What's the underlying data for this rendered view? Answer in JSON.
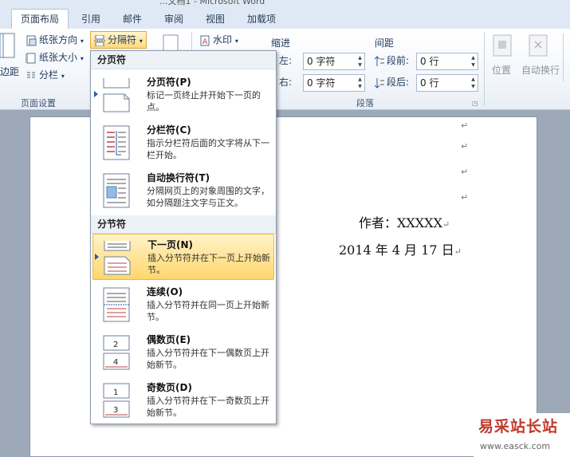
{
  "window": {
    "title_fragment": "...文档1 - Microsoft Word"
  },
  "tabs": [
    "页面布局",
    "引用",
    "邮件",
    "审阅",
    "视图",
    "加载项"
  ],
  "ribbon": {
    "margins_label": "边距",
    "orientation_label": "纸张方向",
    "size_label": "纸张大小",
    "columns_label": "分栏",
    "breaks_label": "分隔符",
    "watermark_label": "水印",
    "page_setup_group": "页面设置",
    "indent_label": "缩进",
    "indent_left_label": "左:",
    "indent_left_value": "0 字符",
    "indent_right_label": "右:",
    "indent_right_value": "0 字符",
    "spacing_label": "间距",
    "spacing_before_label": "段前:",
    "spacing_before_value": "0 行",
    "spacing_after_label": "段后:",
    "spacing_after_value": "0 行",
    "paragraph_group": "段落",
    "position_label": "位置",
    "wrap_label": "自动换行"
  },
  "menu": {
    "page_breaks_header": "分页符",
    "section_breaks_header": "分节符",
    "items": [
      {
        "title": "分页符(P)",
        "desc": "标记一页终止并开始下一页的点。"
      },
      {
        "title": "分栏符(C)",
        "desc": "指示分栏符后面的文字将从下一栏开始。"
      },
      {
        "title": "自动换行符(T)",
        "desc": "分隔网页上的对象周围的文字，如分隔题注文字与正文。"
      },
      {
        "title": "下一页(N)",
        "desc": "插入分节符并在下一页上开始新节。"
      },
      {
        "title": "连续(O)",
        "desc": "插入分节符并在同一页上开始新节。"
      },
      {
        "title": "偶数页(E)",
        "desc": "插入分节符并在下一偶数页上开始新节。"
      },
      {
        "title": "奇数页(D)",
        "desc": "插入分节符并在下一奇数页上开始新节。"
      }
    ],
    "even_icon_numbers": [
      "2",
      "4"
    ],
    "odd_icon_numbers": [
      "1",
      "3"
    ]
  },
  "document": {
    "author_line": "作者：XXXXX",
    "date_line": "2014 年 4 月 17 日",
    "para_mark": "↵"
  },
  "watermark": {
    "site_cn": "易采站长站",
    "site_url": "www.easck.com"
  },
  "colors": {
    "ribbon_bg": "#f1f5fa",
    "hover": "#ffd66d",
    "accent": "#2a5aa8",
    "watermark_red": "#c0392b"
  }
}
